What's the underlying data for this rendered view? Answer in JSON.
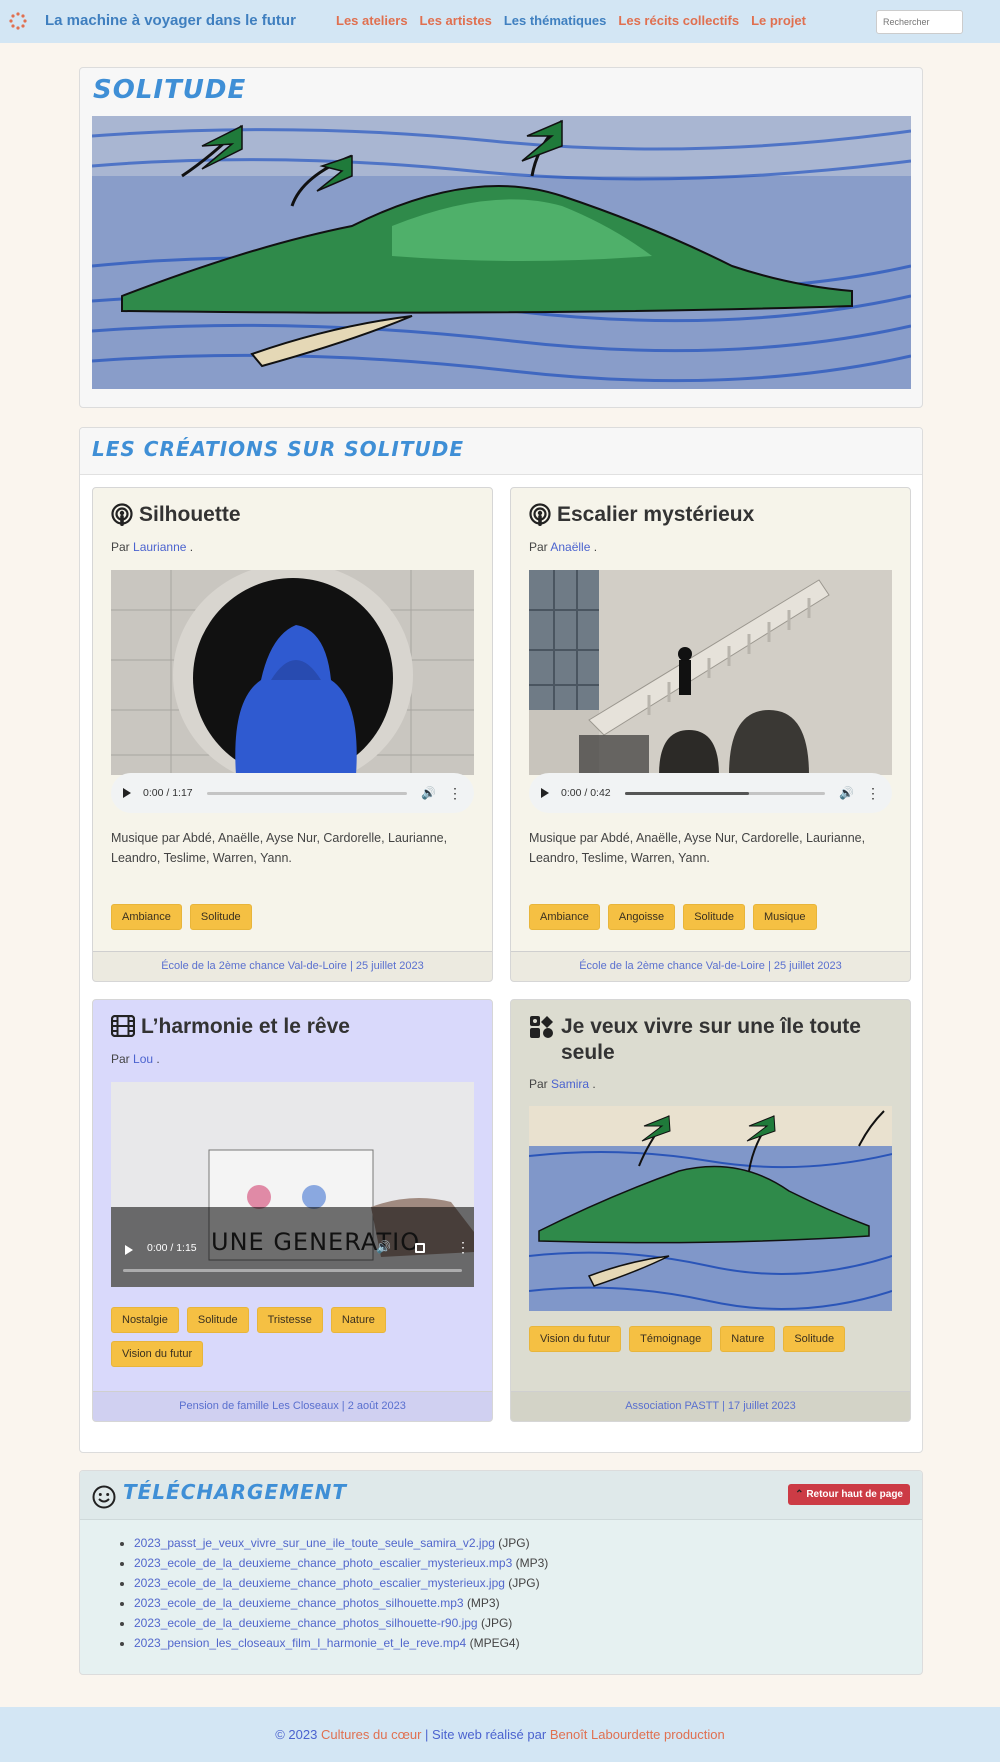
{
  "nav": {
    "brand": "La machine à voyager dans le futur",
    "links": [
      {
        "label": "Les ateliers",
        "color": "#e07050"
      },
      {
        "label": "Les artistes",
        "color": "#e07050"
      },
      {
        "label": "Les thématiques",
        "color": "#4080c0"
      },
      {
        "label": "Les récits collectifs",
        "color": "#e07050"
      },
      {
        "label": "Le projet",
        "color": "#e07050"
      }
    ],
    "search_placeholder": "Rechercher"
  },
  "hero": {
    "title": "SOLITUDE"
  },
  "creations": {
    "title": "LES CRÉATIONS SUR SOLITUDE",
    "cards": [
      {
        "title": "Silhouette",
        "type_icon": "podcast-icon",
        "by_prefix": "Par",
        "author": "Laurianne",
        "audio_time": "0:00 / 1:17",
        "audio_progress": 0.0,
        "description": "Musique par Abdé, Anaëlle, Ayse Nur, Cardorelle, Laurianne, Leandro, Teslime, Warren, Yann.",
        "tags": [
          "Ambiance",
          "Solitude"
        ],
        "footer": "École de la 2ème chance Val-de-Loire | 25 juillet 2023",
        "bg": "#f6f4ea"
      },
      {
        "title": "Escalier mystérieux",
        "type_icon": "podcast-icon",
        "by_prefix": "Par",
        "author": "Anaëlle",
        "audio_time": "0:00 / 0:42",
        "audio_progress": 0.62,
        "description": "Musique par Abdé, Anaëlle, Ayse Nur, Cardorelle, Laurianne, Leandro, Teslime, Warren, Yann.",
        "tags": [
          "Ambiance",
          "Angoisse",
          "Solitude",
          "Musique"
        ],
        "footer": "École de la 2ème chance Val-de-Loire | 25 juillet 2023",
        "bg": "#f6f4ea"
      },
      {
        "title": "L’harmonie et le rêve",
        "type_icon": "film-icon",
        "by_prefix": "Par",
        "author": "Lou",
        "video_time": "0:00 / 1:15",
        "video_caption": "UNE GENERATIO",
        "tags": [
          "Nostalgie",
          "Solitude",
          "Tristesse",
          "Nature",
          "Vision du futur"
        ],
        "footer": "Pension de famille Les Closeaux | 2 août 2023",
        "bg": "#d9d9fb"
      },
      {
        "title": "Je veux vivre sur une île toute seule",
        "type_icon": "photo-icon",
        "by_prefix": "Par",
        "author": "Samira",
        "tags": [
          "Vision du futur",
          "Témoignage",
          "Nature",
          "Solitude"
        ],
        "footer": "Association PASTT | 17 juillet 2023",
        "bg": "#dcdcd0"
      }
    ]
  },
  "downloads": {
    "title": "TÉLÉCHARGEMENT",
    "back_button": "Retour haut de page",
    "files": [
      {
        "name": "2023_passt_je_veux_vivre_sur_une_ile_toute_seule_samira_v2.jpg",
        "type": "(JPG)"
      },
      {
        "name": "2023_ecole_de_la_deuxieme_chance_photo_escalier_mysterieux.mp3",
        "type": "(MP3)"
      },
      {
        "name": "2023_ecole_de_la_deuxieme_chance_photo_escalier_mysterieux.jpg",
        "type": "(JPG)"
      },
      {
        "name": "2023_ecole_de_la_deuxieme_chance_photos_silhouette.mp3",
        "type": "(MP3)"
      },
      {
        "name": "2023_ecole_de_la_deuxieme_chance_photos_silhouette-r90.jpg",
        "type": "(JPG)"
      },
      {
        "name": "2023_pension_les_closeaux_film_l_harmonie_et_le_reve.mp4",
        "type": "(MPEG4)"
      }
    ]
  },
  "footer": {
    "copyright": "© 2023",
    "org": "Cultures du cœur",
    "separator": "| Site web réalisé par",
    "credit": "Benoît Labourdette production"
  }
}
